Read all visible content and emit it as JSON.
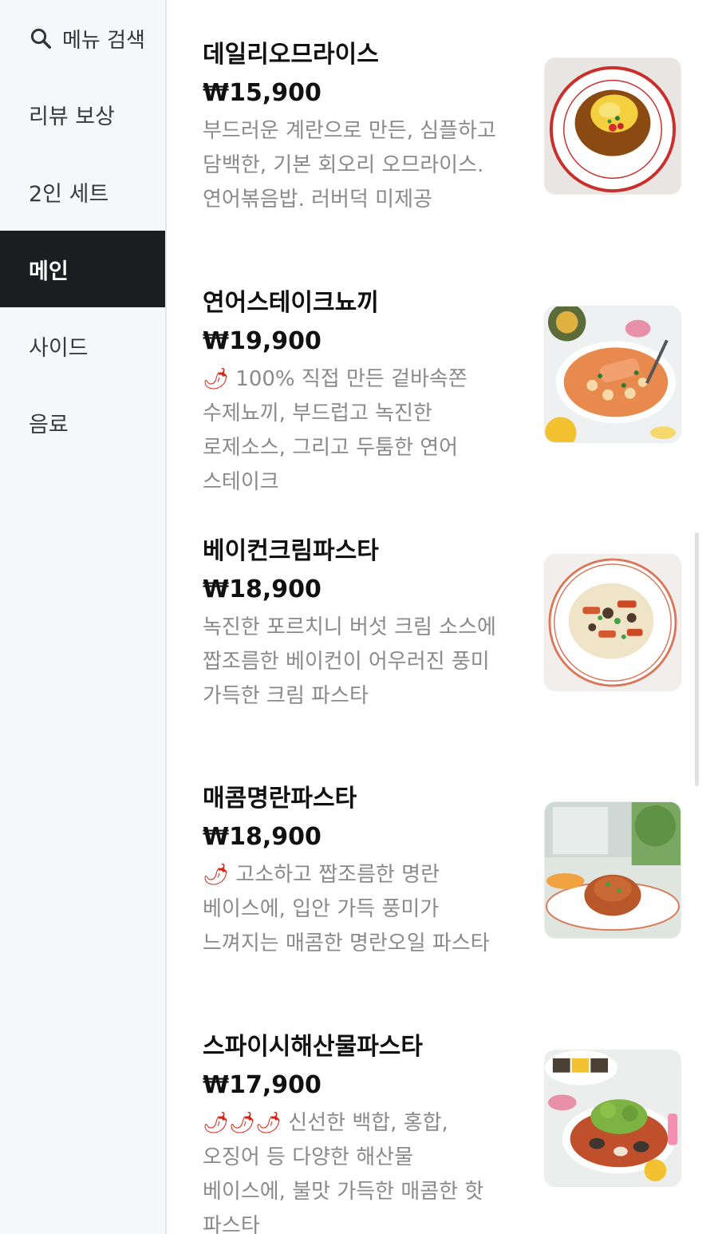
{
  "sidebar": {
    "search_label": "메뉴 검색",
    "categories": [
      {
        "label": "리뷰 보상",
        "active": false
      },
      {
        "label": "2인 세트",
        "active": false
      },
      {
        "label": "메인",
        "active": true
      },
      {
        "label": "사이드",
        "active": false
      },
      {
        "label": "음료",
        "active": false
      }
    ]
  },
  "menu": [
    {
      "name": "데일리오므라이스",
      "price": "₩15,900",
      "spicy": "",
      "description": "부드러운 계란으로 만든, 심플하고 담백한, 기본 회오리 오므라이스. 연어볶음밥. 러버덕 미제공",
      "image": "omurice-photo"
    },
    {
      "name": "연어스테이크뇨끼",
      "price": "₩19,900",
      "spicy": "🌶",
      "description": "100% 직접 만든 겉바속쫀 수제뇨끼, 부드럽고 녹진한 로제소스, 그리고 두툼한 연어 스테이크",
      "image": "salmon-gnocchi-photo"
    },
    {
      "name": "베이컨크림파스타",
      "price": "₩18,900",
      "spicy": "",
      "description": "녹진한 포르치니 버섯 크림 소스에 짭조름한 베이컨이 어우러진 풍미 가득한 크림 파스타",
      "image": "bacon-cream-pasta-photo"
    },
    {
      "name": "매콤명란파스타",
      "price": "₩18,900",
      "spicy": "🌶",
      "description": "고소하고 짭조름한 명란 베이스에, 입안 가득 풍미가 느껴지는 매콤한 명란오일 파스타",
      "image": "spicy-mentaiko-pasta-photo"
    },
    {
      "name": "스파이시해산물파스타",
      "price": "₩17,900",
      "spicy": "🌶🌶🌶",
      "description": "신선한 백합, 홍합, 오징어 등 다양한 해산물 베이스에, 불맛 가득한 매콤한 핫 파스타",
      "image": "spicy-seafood-pasta-photo"
    }
  ],
  "colors": {
    "active_bg": "#1c1d20",
    "sidebar_bg": "#f6f7f9",
    "desc_text": "#8a8a8a",
    "chili": "#d8261b"
  }
}
